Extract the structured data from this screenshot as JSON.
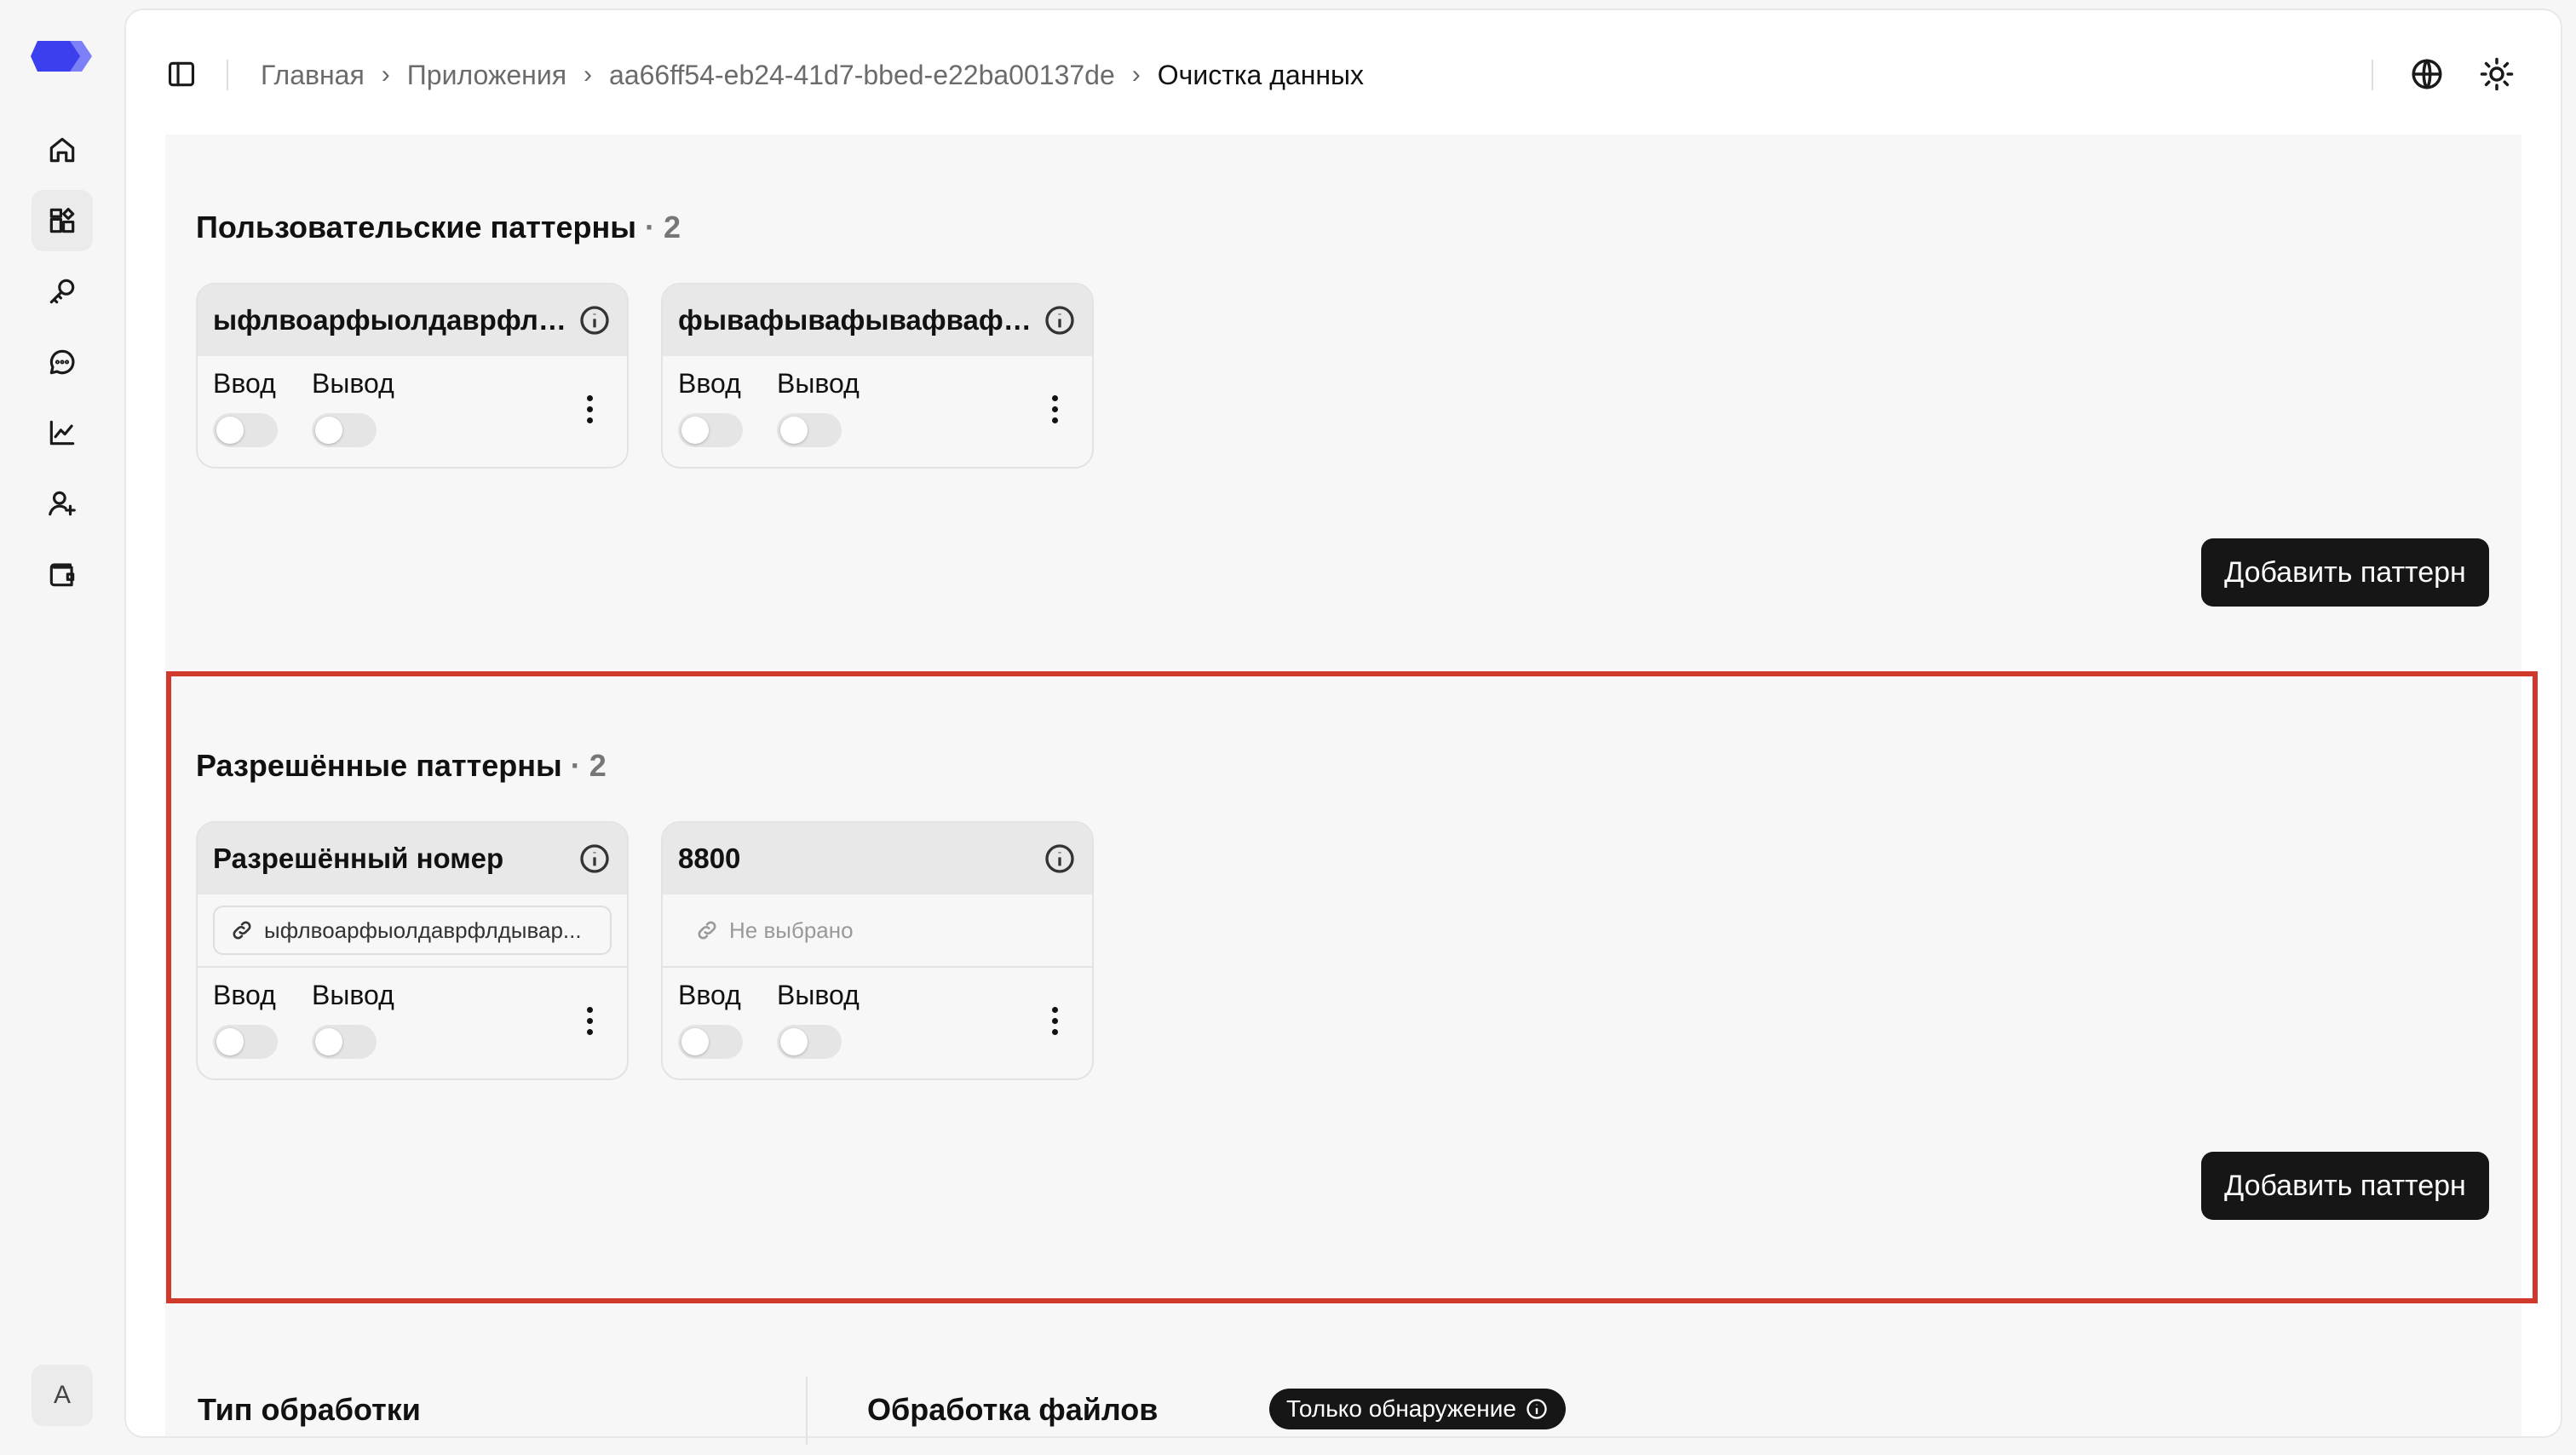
{
  "breadcrumbs": {
    "home": "Главная",
    "apps": "Приложения",
    "app_id": "aa66ff54-eb24-41d7-bbed-e22ba00137de",
    "current": "Очистка данных"
  },
  "rail": {
    "avatar": "A",
    "icons": [
      "home-icon",
      "apps-icon",
      "key-icon",
      "chat-icon",
      "chart-icon",
      "user-plus-icon",
      "wallet-icon"
    ],
    "active_item": "apps-icon"
  },
  "custom_patterns": {
    "title": "Пользовательские паттерны",
    "count": "· 2",
    "cards": [
      {
        "title": "ыфлвоарфыолдаврфлд...",
        "input_label": "Ввод",
        "output_label": "Вывод",
        "input_on": false,
        "output_on": false
      },
      {
        "title": "фывафывафывафвафы...",
        "input_label": "Ввод",
        "output_label": "Вывод",
        "input_on": false,
        "output_on": false
      }
    ],
    "add_button": "Добавить паттерн"
  },
  "allowed_patterns": {
    "title": "Разрешённые паттерны",
    "count": "· 2",
    "cards": [
      {
        "title": "Разрешённый номер",
        "link": "ыфлвоарфыолдаврфлдывар...",
        "link_selected": true,
        "input_label": "Ввод",
        "output_label": "Вывод",
        "input_on": false,
        "output_on": false
      },
      {
        "title": "8800",
        "link": "Не выбрано",
        "link_selected": false,
        "input_label": "Ввод",
        "output_label": "Вывод",
        "input_on": false,
        "output_on": false
      }
    ],
    "add_button": "Добавить паттерн"
  },
  "processing": {
    "type_title": "Тип обработки",
    "files_title": "Обработка файлов",
    "files_badge": "Только обнаружение"
  },
  "colors": {
    "accent_logo": "#4a4ef0",
    "highlight_border": "#d0392b",
    "button_bg": "#161616"
  }
}
